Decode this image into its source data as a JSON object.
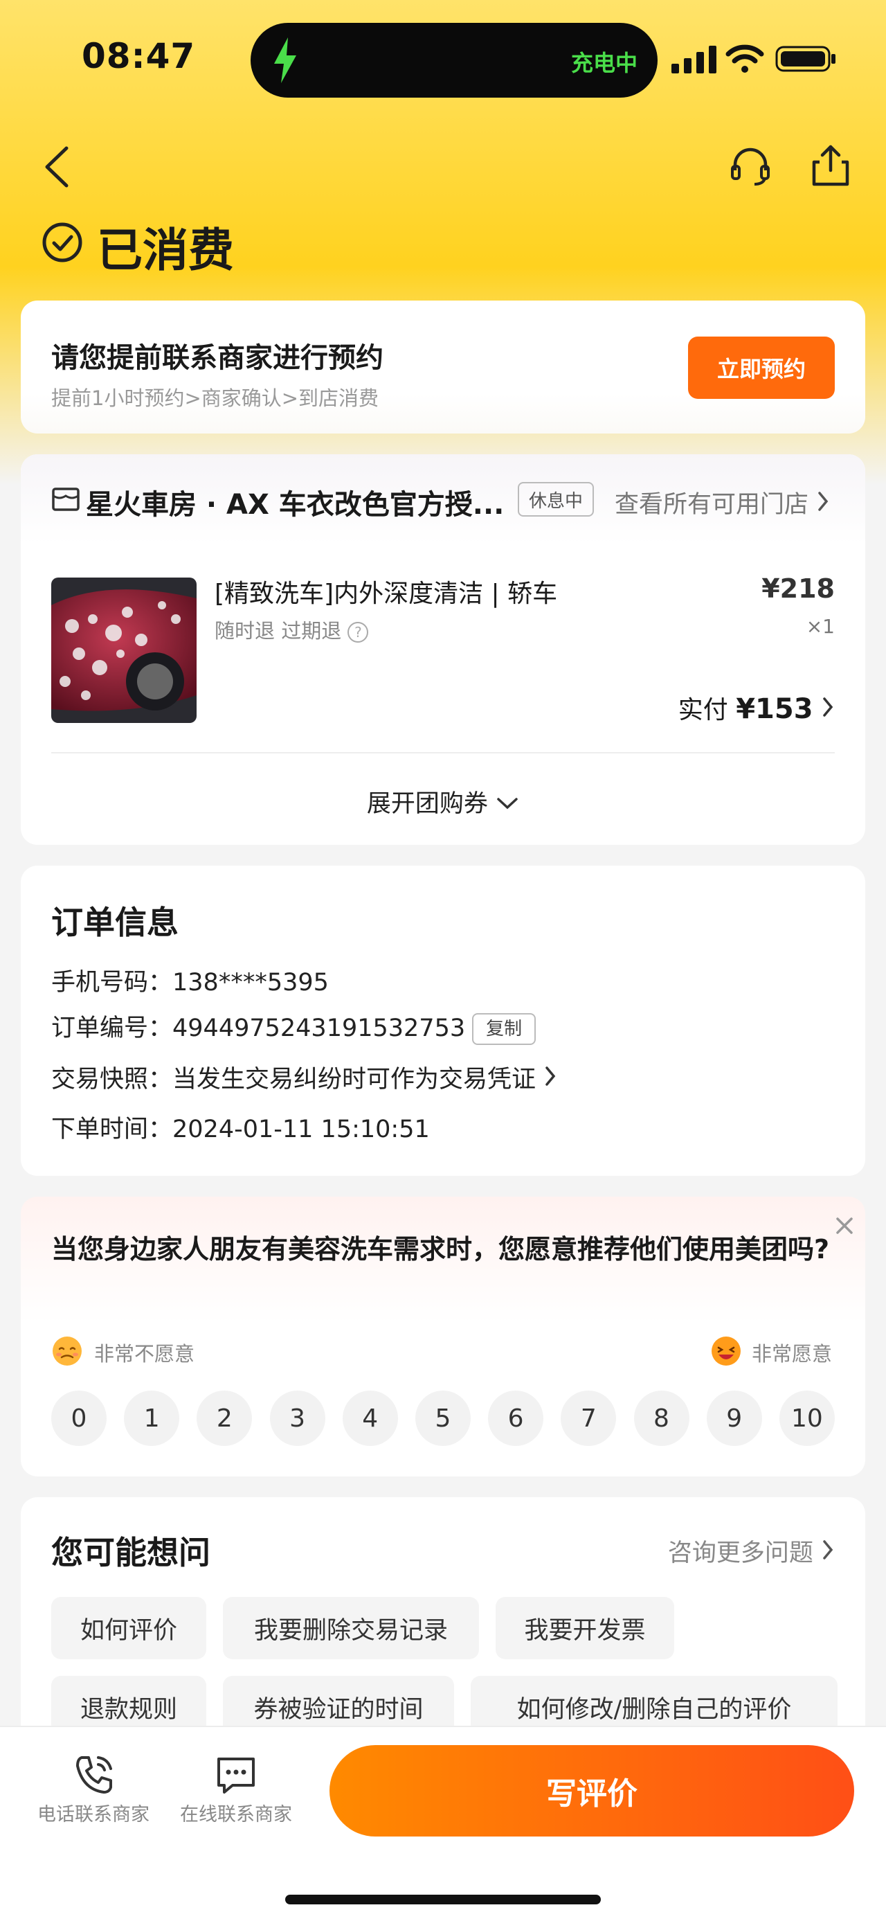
{
  "status_bar": {
    "time": "08:47",
    "charging_label": "充电中"
  },
  "header": {
    "status_title": "已消费"
  },
  "appointment": {
    "title": "请您提前联系商家进行预约",
    "subtitle": "提前1小时预约>商家确认>到店消费",
    "button_label": "立即预约"
  },
  "store": {
    "name": "星火車房 · AX 车衣改色官方授...",
    "status_badge": "休息中",
    "all_stores_link": "查看所有可用门店",
    "product": {
      "title": "[精致洗车]内外深度清洁 | 轿车",
      "tags": "随时退  过期退",
      "price": "¥218",
      "quantity": "×1",
      "paid_label": "实付",
      "paid_amount": "¥153"
    },
    "expand_label": "展开团购券"
  },
  "order_info": {
    "title": "订单信息",
    "phone_label": "手机号码：",
    "phone": "138****5395",
    "order_no_label": "订单编号：",
    "order_no": "4944975243191532753",
    "copy_label": "复制",
    "snapshot_label": "交易快照：",
    "snapshot": "当发生交易纠纷时可作为交易凭证",
    "time_label": "下单时间：",
    "time": "2024-01-11 15:10:51"
  },
  "survey": {
    "question": "当您身边家人朋友有美容洗车需求时，您愿意推荐他们使用美团吗?",
    "low_label": "非常不愿意",
    "high_label": "非常愿意",
    "scores": [
      "0",
      "1",
      "2",
      "3",
      "4",
      "5",
      "6",
      "7",
      "8",
      "9",
      "10"
    ]
  },
  "faq": {
    "title": "您可能想问",
    "more_link": "咨询更多问题",
    "chips": [
      "如何评价",
      "我要删除交易记录",
      "我要开发票",
      "退款规则",
      "券被验证的时间",
      "如何修改/删除自己的评价"
    ]
  },
  "bottom_bar": {
    "phone_label": "电话联系商家",
    "chat_label": "在线联系商家",
    "review_label": "写评价"
  },
  "colors": {
    "brand_yellow": "#ffd21f",
    "accent_orange": "#ff6a0c",
    "charging_green": "#4ade4a"
  }
}
